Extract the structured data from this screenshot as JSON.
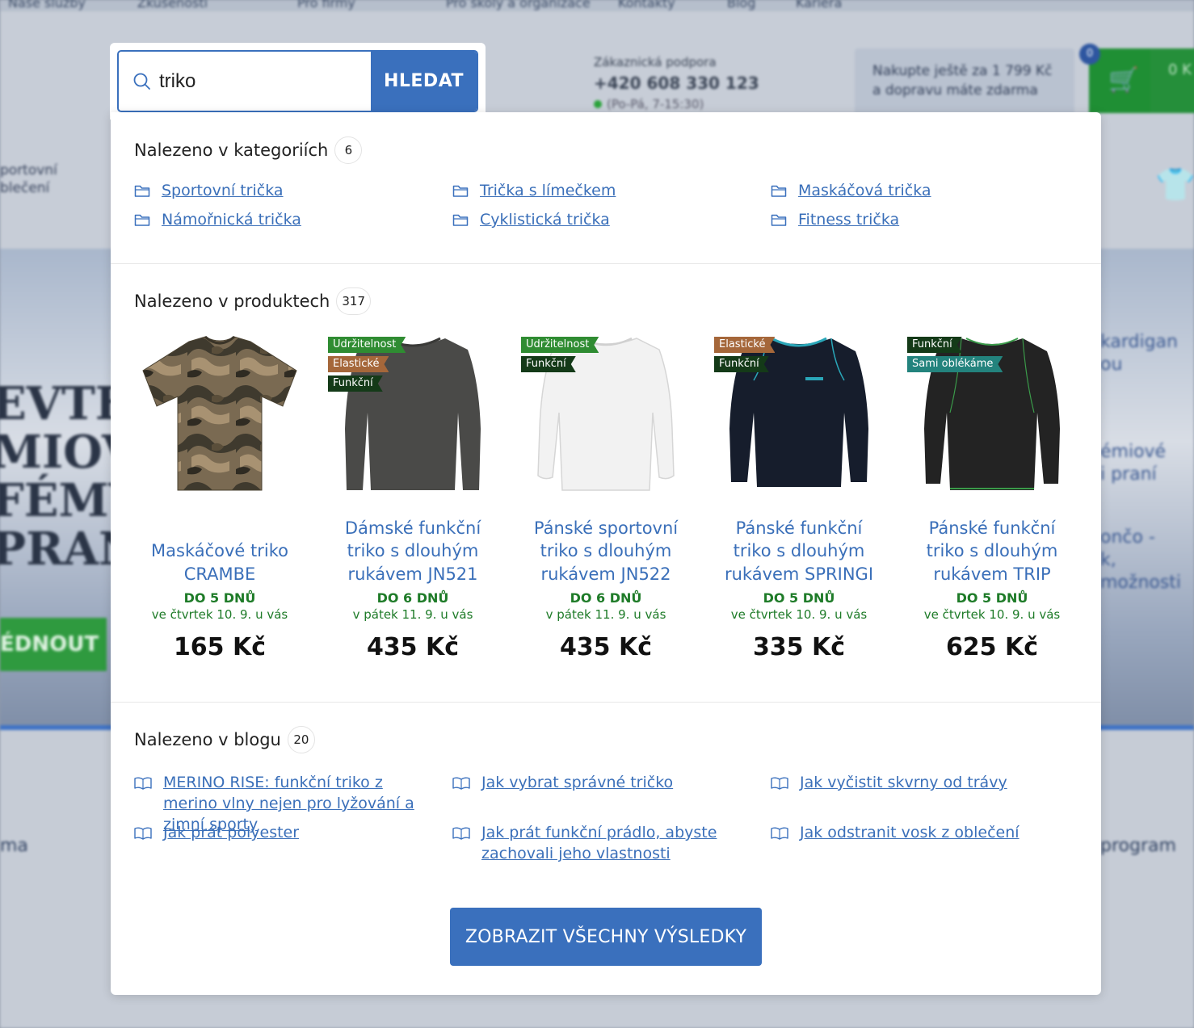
{
  "background": {
    "top_nav": [
      "Naše služby",
      "Zkušenosti",
      "Pro firmy",
      "Pro školy a organizace",
      "Kontakty",
      "Blog",
      "Kariéra"
    ],
    "support_label": "Zákaznická podpora",
    "support_phone_prefix": "+420",
    "support_phone": "608 330 123",
    "support_hours": "(Po-Pá, 7-15:30)",
    "free_shipping_line1": "Nakupte ještě za 1 799 Kč",
    "free_shipping_line2": "a dopravu máte zdarma",
    "cart_count": "0",
    "cart_total": "0 K",
    "sport_line1": "portovní",
    "sport_line2": "blečení",
    "hero_line1": "EVTE",
    "hero_line2": "MIOV",
    "hero_line3": "FÉMY",
    "hero_line4": "PRANÍ",
    "hero_button": "ÉDNOUT",
    "right_col": [
      "kardigan",
      "ou",
      "émiové",
      "i praní",
      "ončo -",
      "k,",
      "možnosti"
    ],
    "lower_left": "ma",
    "lower_right": "program"
  },
  "search": {
    "value": "triko",
    "button_label": "HLEDAT"
  },
  "categories": {
    "heading": "Nalezeno v kategoriích",
    "count": "6",
    "items": [
      {
        "label": "Sportovní trička"
      },
      {
        "label": "Trička s límečkem"
      },
      {
        "label": "Maskáčová trička"
      },
      {
        "label": "Námořnická trička"
      },
      {
        "label": "Cyklistická trička"
      },
      {
        "label": "Fitness trička"
      }
    ]
  },
  "products": {
    "heading": "Nalezeno v produktech",
    "count": "317",
    "items": [
      {
        "name": "Maskáčové triko CRAMBE",
        "tags": [],
        "delivery_days": "DO 5 DNŮ",
        "delivery_date": "ve čtvrtek 10. 9. u vás",
        "price": "165 Kč",
        "image": "camo-tshirt"
      },
      {
        "name": "Dámské funkční triko s dlouhým rukávem JN521",
        "tags": [
          {
            "label": "Udržitelnost",
            "color": "green"
          },
          {
            "label": "Elastické",
            "color": "brown"
          },
          {
            "label": "Funkční",
            "color": "dark"
          }
        ],
        "delivery_days": "DO 6 DNŮ",
        "delivery_date": "v pátek 11. 9. u vás",
        "price": "435 Kč",
        "image": "grey-longsleeve"
      },
      {
        "name": "Pánské sportovní triko s dlouhým rukávem JN522",
        "tags": [
          {
            "label": "Udržitelnost",
            "color": "green"
          },
          {
            "label": "Funkční",
            "color": "dark"
          }
        ],
        "delivery_days": "DO 6 DNŮ",
        "delivery_date": "v pátek 11. 9. u vás",
        "price": "435 Kč",
        "image": "white-longsleeve"
      },
      {
        "name": "Pánské funkční triko s dlouhým rukávem SPRINGI",
        "tags": [
          {
            "label": "Elastické",
            "color": "brown"
          },
          {
            "label": "Funkční",
            "color": "dark"
          }
        ],
        "delivery_days": "DO 5 DNŮ",
        "delivery_date": "ve čtvrtek 10. 9. u vás",
        "price": "335 Kč",
        "image": "navy-longsleeve"
      },
      {
        "name": "Pánské funkční triko s dlouhým rukávem TRIP",
        "tags": [
          {
            "label": "Funkční",
            "color": "dark"
          },
          {
            "label": "Sami oblékáme",
            "color": "teal"
          }
        ],
        "delivery_days": "DO 5 DNŮ",
        "delivery_date": "ve čtvrtek 10. 9. u vás",
        "price": "625 Kč",
        "image": "black-longsleeve"
      }
    ]
  },
  "blog": {
    "heading": "Nalezeno v blogu",
    "count": "20",
    "items": [
      {
        "label": "MERINO RISE: funkční triko z merino vlny nejen pro lyžování a zimní sporty"
      },
      {
        "label": "Jak vybrat správné tričko"
      },
      {
        "label": "Jak vyčistit skvrny od trávy"
      },
      {
        "label": "Jak prát polyester"
      },
      {
        "label": "Jak prát funkční prádlo, abyste zachovali jeho vlastnosti"
      },
      {
        "label": "Jak odstranit vosk z oblečení"
      }
    ]
  },
  "show_all_label": "ZOBRAZIT VŠECHNY VÝSLEDKY",
  "colors": {
    "accent": "#3a70bd",
    "link": "#3a6fb9",
    "delivery": "#1e7b28",
    "tag_green": "#2f8c32",
    "tag_brown": "#a5673a",
    "tag_dark": "#143a18",
    "tag_teal": "#23837d"
  }
}
